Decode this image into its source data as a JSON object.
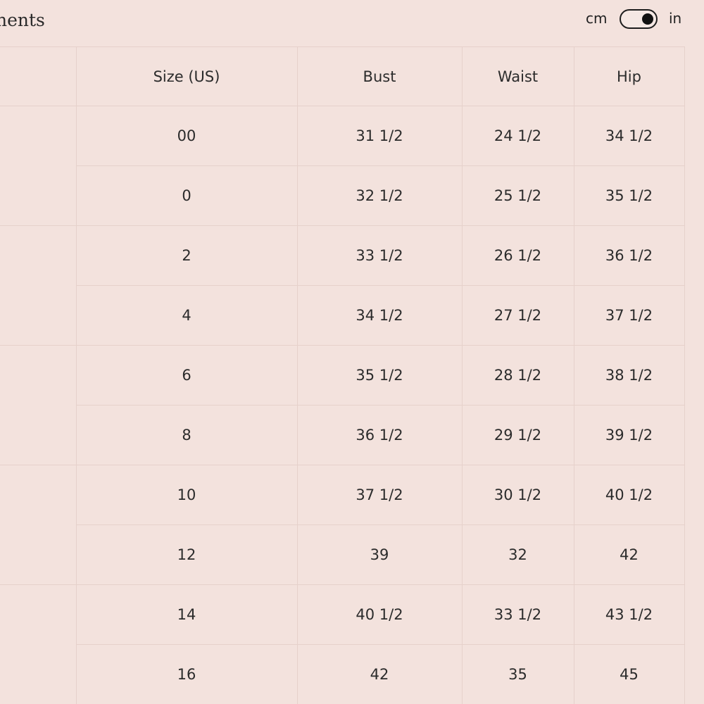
{
  "title": "nents",
  "units": {
    "left": "cm",
    "right": "in",
    "selected": "in"
  },
  "table": {
    "headers": [
      "",
      "Size (US)",
      "Bust",
      "Waist",
      "Hip"
    ],
    "rows": [
      {
        "size": "00",
        "bust": "31 1/2",
        "waist": "24 1/2",
        "hip": "34 1/2"
      },
      {
        "size": "0",
        "bust": "32 1/2",
        "waist": "25 1/2",
        "hip": "35 1/2"
      },
      {
        "size": "2",
        "bust": "33 1/2",
        "waist": "26 1/2",
        "hip": "36 1/2"
      },
      {
        "size": "4",
        "bust": "34 1/2",
        "waist": "27 1/2",
        "hip": "37 1/2"
      },
      {
        "size": "6",
        "bust": "35 1/2",
        "waist": "28 1/2",
        "hip": "38 1/2"
      },
      {
        "size": "8",
        "bust": "36 1/2",
        "waist": "29 1/2",
        "hip": "39 1/2"
      },
      {
        "size": "10",
        "bust": "37 1/2",
        "waist": "30 1/2",
        "hip": "40 1/2"
      },
      {
        "size": "12",
        "bust": "39",
        "waist": "32",
        "hip": "42"
      },
      {
        "size": "14",
        "bust": "40 1/2",
        "waist": "33 1/2",
        "hip": "43 1/2"
      },
      {
        "size": "16",
        "bust": "42",
        "waist": "35",
        "hip": "45"
      }
    ]
  },
  "colors": {
    "background": "#f3e2dd",
    "grid": "#e6d1cb",
    "text": "#222222"
  }
}
